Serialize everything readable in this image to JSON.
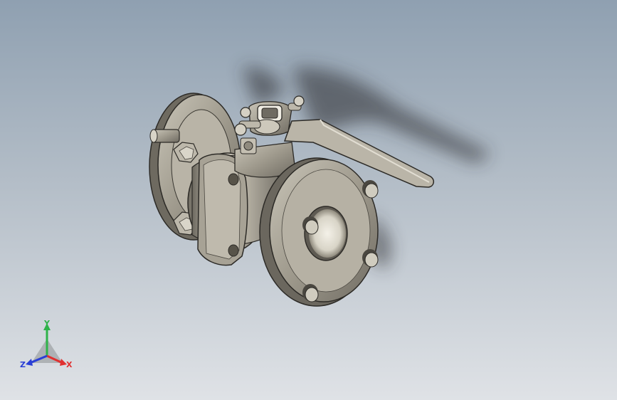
{
  "viewport": {
    "model": "ball-valve-3d-model",
    "background_top": "#8fa0b1",
    "background_bottom": "#dfe2e6",
    "metal_color": "#a9a497"
  },
  "triad": {
    "x_label": "X",
    "y_label": "Y",
    "z_label": "Z",
    "x_color": "#e03030",
    "y_color": "#2fb34a",
    "z_color": "#2a3fd6"
  }
}
